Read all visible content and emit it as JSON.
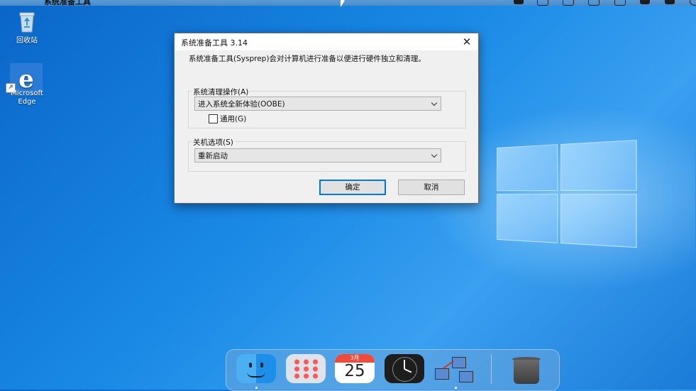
{
  "menubar": {
    "app_title": "系统准备工具",
    "apple_glyph": ""
  },
  "desktop": {
    "icons": [
      {
        "name": "recycle-bin",
        "label": "回收站"
      },
      {
        "name": "edge",
        "label_line1": "Microsoft",
        "label_line2": "Edge"
      }
    ]
  },
  "dialog": {
    "title": "系统准备工具 3.14",
    "close_glyph": "✕",
    "description": "系统准备工具(Sysprep)会对计算机进行准备以便进行硬件独立和清理。",
    "cleanup_group": {
      "label": "系统清理操作(A)",
      "selected": "进入系统全新体验(OOBE)",
      "generalize_label": "通用(G)",
      "generalize_checked": false
    },
    "shutdown_group": {
      "label": "关机选项(S)",
      "selected": "重新启动"
    },
    "ok_label": "确定",
    "cancel_label": "取消"
  },
  "dock": {
    "calendar_month": "3月",
    "calendar_day": "25",
    "apps": [
      "finder-icon",
      "launchpad-icon",
      "calendar-icon",
      "clock-icon",
      "network-icon",
      "trash-icon"
    ]
  },
  "colors": {
    "desktop": "#1a8ae6",
    "dialog_bg": "#f0f0f0",
    "default_button_border": "#0078d7"
  }
}
